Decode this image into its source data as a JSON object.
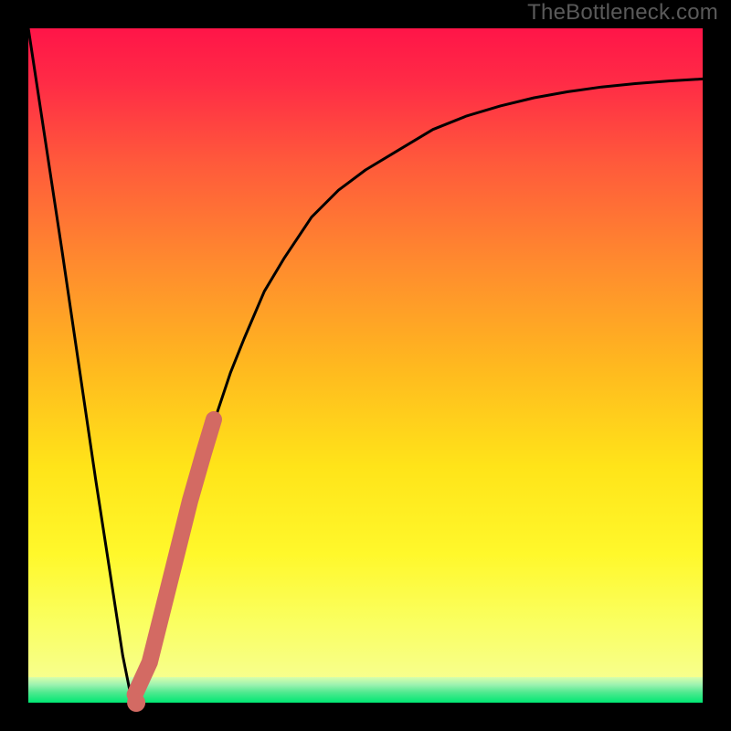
{
  "watermark": "TheBottleneck.com",
  "colors": {
    "frame": "#000000",
    "curve": "#000000",
    "accent": "#d36a63",
    "green": "#00e873",
    "greenFade": "#9cf2b0"
  },
  "chart_data": {
    "type": "line",
    "title": "",
    "xlabel": "",
    "ylabel": "",
    "xlim": [
      0,
      100
    ],
    "ylim": [
      0,
      100
    ],
    "grid": false,
    "series": [
      {
        "name": "bottleneck-curve",
        "x": [
          0,
          5,
          10,
          12,
          14,
          15,
          16,
          17,
          18,
          20,
          22,
          24,
          26,
          28,
          30,
          32,
          35,
          38,
          42,
          46,
          50,
          55,
          60,
          65,
          70,
          75,
          80,
          85,
          90,
          95,
          100
        ],
        "values": [
          100,
          67,
          33,
          20,
          7,
          2,
          0,
          2,
          6,
          14,
          22,
          30,
          37,
          43,
          49,
          54,
          61,
          66,
          72,
          76,
          79,
          82,
          85,
          87,
          88.5,
          89.7,
          90.6,
          91.3,
          91.8,
          92.2,
          92.5
        ]
      },
      {
        "name": "highlight-segment",
        "x": [
          15.8,
          18,
          20,
          22,
          24,
          26,
          27.5
        ],
        "values": [
          1.2,
          6,
          14,
          22,
          30,
          37,
          42
        ]
      }
    ],
    "annotations": []
  }
}
